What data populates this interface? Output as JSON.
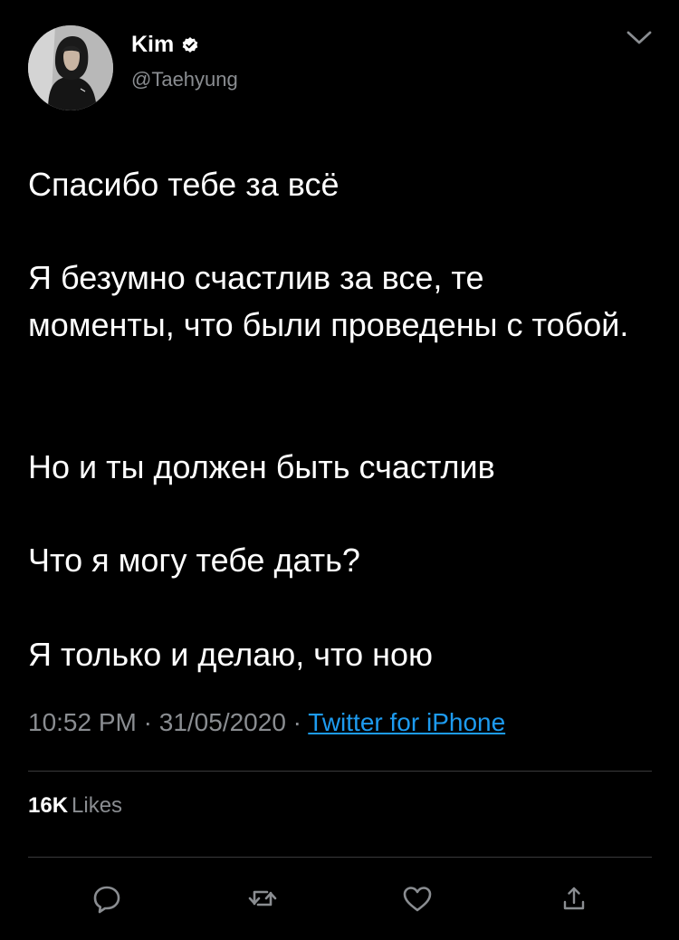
{
  "user": {
    "display_name": "Kim",
    "handle": "@Taehyung",
    "verified": true
  },
  "tweet": {
    "paragraphs": [
      "Спасибо тебе за всё",
      "Я безумно счастлив за все, те моменты, что были проведены с тобой.",
      "Но и ты должен быть счастлив",
      "Что я могу тебе дать?",
      "Я только и делаю, что ною"
    ]
  },
  "meta": {
    "time": "10:52 PM",
    "separator": " · ",
    "date": "31/05/2020",
    "source": "Twitter for iPhone"
  },
  "stats": {
    "likes_count": "16K",
    "likes_label": "Likes"
  },
  "icons": {
    "verified": "verified-badge-icon",
    "menu": "chevron-down-icon",
    "reply": "reply-icon",
    "retweet": "retweet-icon",
    "like": "heart-icon",
    "share": "share-icon"
  },
  "colors": {
    "background": "#000000",
    "text": "#ffffff",
    "secondary_text": "#8a8d91",
    "link": "#1d9bf0",
    "divider": "#3a3a3c"
  }
}
